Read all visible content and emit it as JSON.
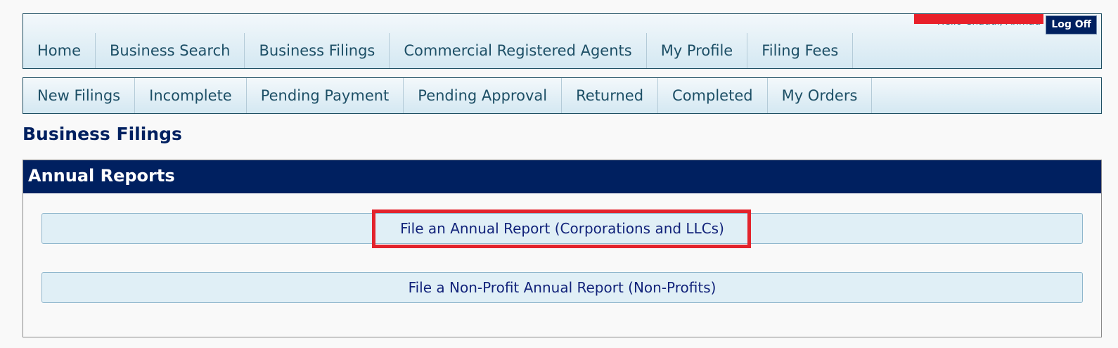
{
  "main_nav": {
    "items": [
      "Home",
      "Business Search",
      "Business Filings",
      "Commercial Registered Agents",
      "My Profile",
      "Filing Fees"
    ],
    "greeting": "Hello Chaudi, Ahmad",
    "logoff_label": "Log Off"
  },
  "sub_nav": {
    "items": [
      "New Filings",
      "Incomplete",
      "Pending Payment",
      "Pending Approval",
      "Returned",
      "Completed",
      "My Orders"
    ]
  },
  "page": {
    "title": "Business Filings"
  },
  "annual_reports": {
    "heading": "Annual Reports",
    "file_annual_report": "File an Annual Report (Corporations and LLCs)",
    "file_nonprofit_report": "File a Non-Profit Annual Report (Non-Profits)"
  },
  "colors": {
    "brand_navy": "#002060",
    "nav_text": "#1d4f66",
    "highlight_red": "#e3232c"
  }
}
